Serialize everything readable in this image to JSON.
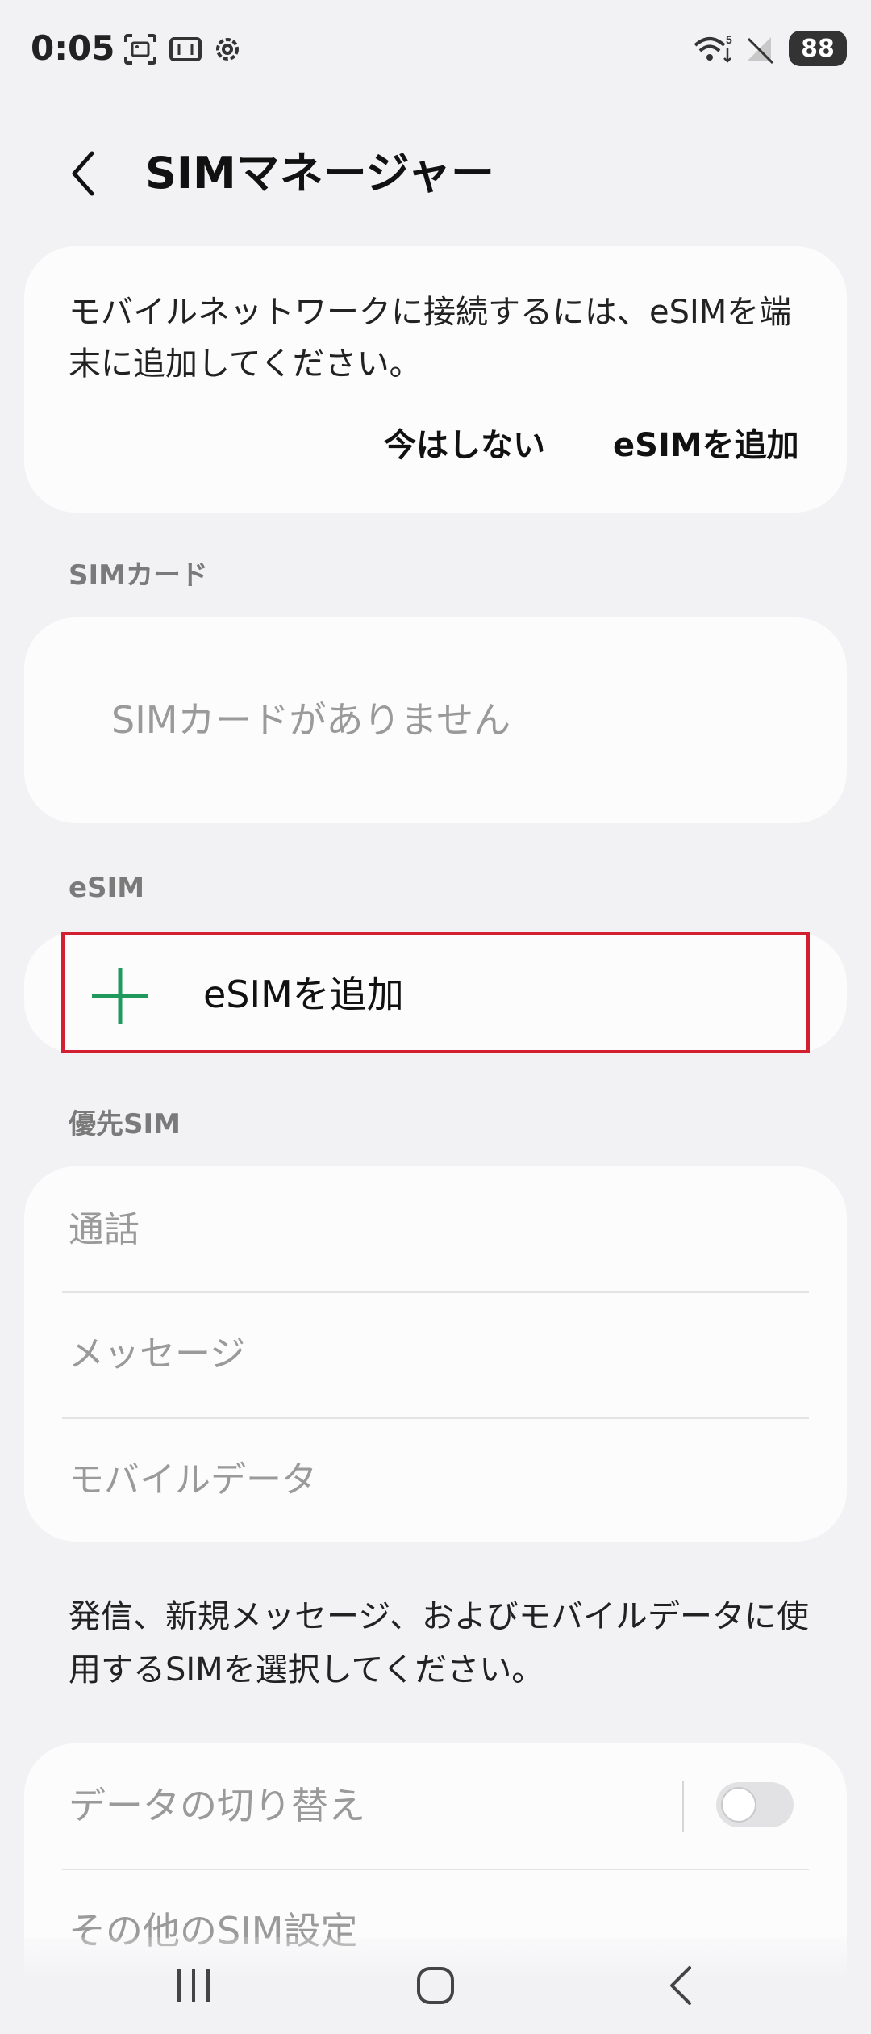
{
  "status_bar": {
    "time": "0:05",
    "battery": "88",
    "icons": [
      "screenshot-icon",
      "display-icon",
      "settings-gear-icon",
      "wifi-5g-icon",
      "no-signal-icon",
      "battery-icon"
    ]
  },
  "header": {
    "title": "SIMマネージャー",
    "back_icon": "back-arrow-icon"
  },
  "prompt_card": {
    "message": "モバイルネットワークに接続するには、eSIMを端末に追加してください。",
    "not_now_label": "今はしない",
    "add_esim_label": "eSIMを追加"
  },
  "sim_card_section": {
    "header": "SIMカード",
    "empty_text": "SIMカードがありません"
  },
  "esim_section": {
    "header": "eSIM",
    "add_label": "eSIMを追加",
    "plus_icon": "plus-icon",
    "accent_color": "#1f9a5c"
  },
  "preferred_sim": {
    "header": "優先SIM",
    "items": [
      {
        "label": "通話"
      },
      {
        "label": "メッセージ"
      },
      {
        "label": "モバイルデータ"
      }
    ]
  },
  "note": "発信、新規メッセージ、およびモバイルデータに使用するSIMを選択してください。",
  "settings": {
    "data_switch_label": "データの切り替え",
    "data_switch_on": false,
    "more_settings_label": "その他のSIM設定"
  },
  "nav_bar": {
    "icons": [
      "recent-apps-icon",
      "home-icon",
      "back-nav-icon"
    ]
  },
  "colors": {
    "background": "#f2f2f4",
    "card": "#fcfcfd",
    "highlight_border": "#d32030"
  }
}
